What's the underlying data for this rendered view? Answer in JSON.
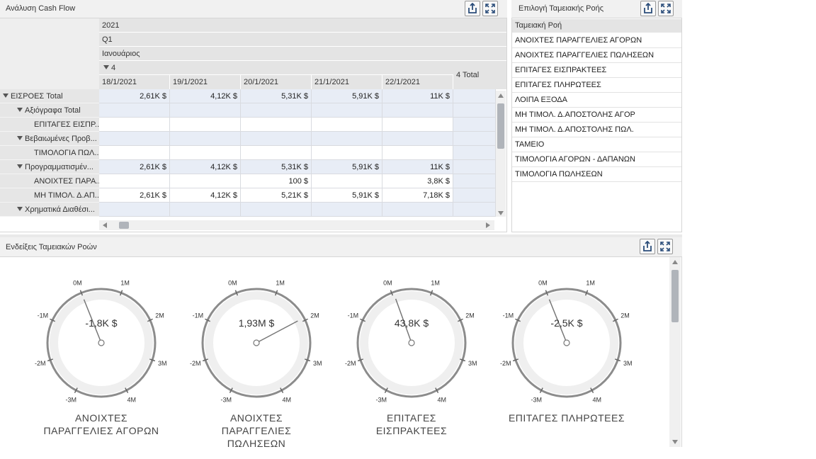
{
  "cashflow_panel": {
    "title": "Ανάλυση Cash Flow"
  },
  "pivot": {
    "year": "2021",
    "quarter": "Q1",
    "month": "Ιανουάριος",
    "week": "4",
    "week_total": "4 Total",
    "dates": [
      "18/1/2021",
      "19/1/2021",
      "20/1/2021",
      "21/1/2021",
      "22/1/2021"
    ],
    "rows": [
      {
        "label": "ΕΙΣΡΟΕΣ Total",
        "level": 0,
        "expand": true,
        "values": [
          "2,61K $",
          "4,12K $",
          "5,31K $",
          "5,91K $",
          "11K $",
          ""
        ]
      },
      {
        "label": "Αξιόγραφα Total",
        "level": 1,
        "expand": true,
        "values": [
          "",
          "",
          "",
          "",
          "",
          ""
        ]
      },
      {
        "label": "ΕΠΙΤΑΓΕΣ ΕΙΣΠΡ...",
        "level": 2,
        "expand": false,
        "values": [
          "",
          "",
          "",
          "",
          "",
          ""
        ]
      },
      {
        "label": "Βεβαιωμένες Προβ...",
        "level": 1,
        "expand": true,
        "values": [
          "",
          "",
          "",
          "",
          "",
          ""
        ]
      },
      {
        "label": "ΤΙΜΟΛΟΓΙΑ ΠΩΛ...",
        "level": 2,
        "expand": false,
        "values": [
          "",
          "",
          "",
          "",
          "",
          ""
        ]
      },
      {
        "label": "Προγραμματισμέν...",
        "level": 1,
        "expand": true,
        "values": [
          "2,61K $",
          "4,12K $",
          "5,31K $",
          "5,91K $",
          "11K $",
          ""
        ]
      },
      {
        "label": "ΑΝΟΙΧΤΕΣ ΠΑΡΑ...",
        "level": 2,
        "expand": false,
        "values": [
          "",
          "",
          "100 $",
          "",
          "3,8K $",
          ""
        ]
      },
      {
        "label": "ΜΗ ΤΙΜΟΛ. Δ.ΑΠ...",
        "level": 2,
        "expand": false,
        "values": [
          "2,61K $",
          "4,12K $",
          "5,21K $",
          "5,91K $",
          "7,18K $",
          ""
        ]
      },
      {
        "label": "Χρηματικά Διαθέσι...",
        "level": 1,
        "expand": true,
        "values": [
          "",
          "",
          "",
          "",
          "",
          ""
        ]
      }
    ]
  },
  "selection_panel": {
    "title": "Επιλογή Ταμειακής Ροής",
    "column_header": "Ταμειακή Ροή",
    "items": [
      "ΑΝΟΙΧΤΕΣ ΠΑΡΑΓΓΕΛΙΕΣ ΑΓΟΡΩΝ",
      "ΑΝΟΙΧΤΕΣ ΠΑΡΑΓΓΕΛΙΕΣ ΠΩΛΗΣΕΩΝ",
      "ΕΠΙΤΑΓΕΣ ΕΙΣΠΡΑΚΤΕΕΣ",
      "ΕΠΙΤΑΓΕΣ ΠΛΗΡΩΤΕΕΣ",
      "ΛΟΙΠΑ ΕΞΟΔΑ",
      "ΜΗ ΤΙΜΟΛ. Δ.ΑΠΟΣΤΟΛΗΣ ΑΓΟΡ",
      "ΜΗ ΤΙΜΟΛ. Δ.ΑΠΟΣΤΟΛΗΣ ΠΩΛ.",
      "ΤΑΜΕΙΟ",
      "ΤΙΜΟΛΟΓΙΑ ΑΓΟΡΩΝ - ΔΑΠΑΝΩΝ",
      "ΤΙΜΟΛΟΓΙΑ ΠΩΛΗΣΕΩΝ"
    ]
  },
  "gauges_panel": {
    "title": "Ενδείξεις Ταμειακών Ροών",
    "scale_labels": [
      "-3M",
      "-2M",
      "-1M",
      "0M",
      "1M",
      "2M",
      "3M",
      "4M"
    ],
    "scale_min_millions": -3,
    "scale_max_millions": 4,
    "gauges": [
      {
        "value_label": "-1,8K $",
        "value_millions": -0.0018,
        "title_lines": [
          "ΑΝΟΙΧΤΕΣ",
          "ΠΑΡΑΓΓΕΛΙΕΣ ΑΓΟΡΩΝ"
        ]
      },
      {
        "value_label": "1,93M $",
        "value_millions": 1.93,
        "title_lines": [
          "ΑΝΟΙΧΤΕΣ",
          "ΠΑΡΑΓΓΕΛΙΕΣ",
          "ΠΩΛΗΣΕΩΝ"
        ]
      },
      {
        "value_label": "43,8K $",
        "value_millions": 0.0438,
        "title_lines": [
          "ΕΠΙΤΑΓΕΣ",
          "ΕΙΣΠΡΑΚΤΕΕΣ"
        ]
      },
      {
        "value_label": "-2,5K $",
        "value_millions": -0.0025,
        "title_lines": [
          "ΕΠΙΤΑΓΕΣ ΠΛΗΡΩΤΕΕΣ"
        ]
      }
    ]
  },
  "colors": {
    "header_bg": "#f1f1f1",
    "row_shade": "#e8edf6",
    "pivot_header": "#e4e4e4",
    "gauge_ring": "#8c8c8c"
  }
}
